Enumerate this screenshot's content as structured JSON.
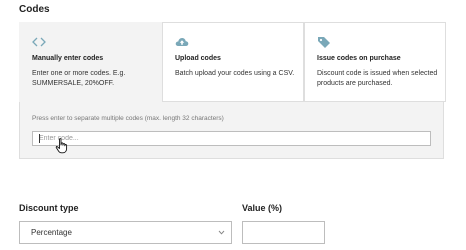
{
  "codes": {
    "title": "Codes",
    "options": [
      {
        "icon": "code-brackets-icon",
        "title": "Manually enter codes",
        "description": "Enter one or more codes. E.g. SUMMERSALE, 20%OFF.",
        "selected": true
      },
      {
        "icon": "cloud-upload-icon",
        "title": "Upload codes",
        "description": "Batch upload your codes using a CSV.",
        "selected": false
      },
      {
        "icon": "tag-icon",
        "title": "Issue codes on purchase",
        "description": "Discount code is issued when selected products are purchased.",
        "selected": false
      }
    ],
    "hint": "Press enter to separate multiple codes (max. length 32 characters)",
    "input_placeholder": "Enter code..."
  },
  "discount_type": {
    "label": "Discount type",
    "selected": "Percentage"
  },
  "value": {
    "label": "Value (%)",
    "current": ""
  },
  "colors": {
    "icon": "#7aa8b8",
    "panel_bg": "#f3f3f3",
    "border": "#dedede"
  }
}
